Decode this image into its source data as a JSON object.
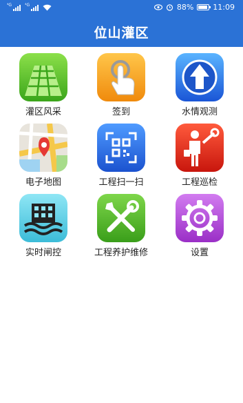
{
  "status": {
    "network_left": "⁴G",
    "network_right": "⁴G",
    "battery": "88%",
    "time": "11:09"
  },
  "header": {
    "title": "位山灌区"
  },
  "menu": [
    {
      "label": "灌区风采",
      "icon": "farmland-icon"
    },
    {
      "label": "签到",
      "icon": "tap-hand-icon"
    },
    {
      "label": "水情观测",
      "icon": "arrow-up-icon"
    },
    {
      "label": "电子地图",
      "icon": "map-pin-icon"
    },
    {
      "label": "工程扫一扫",
      "icon": "qr-scan-icon"
    },
    {
      "label": "工程巡检",
      "icon": "worker-wrench-icon"
    },
    {
      "label": "实时闸控",
      "icon": "sluice-gate-icon"
    },
    {
      "label": "工程养护维修",
      "icon": "repair-tools-icon"
    },
    {
      "label": "设置",
      "icon": "gear-icon"
    }
  ],
  "colors": {
    "header_bg": "#2b72d6",
    "farmland": "#5cc52b",
    "sign_in": "#f5a623",
    "water": "#1d6fe0",
    "scan": "#2a6ee0",
    "patrol": "#e02b1f",
    "gate": "#5fd0e6",
    "repair": "#57c32d",
    "settings": "#b14ad8"
  }
}
